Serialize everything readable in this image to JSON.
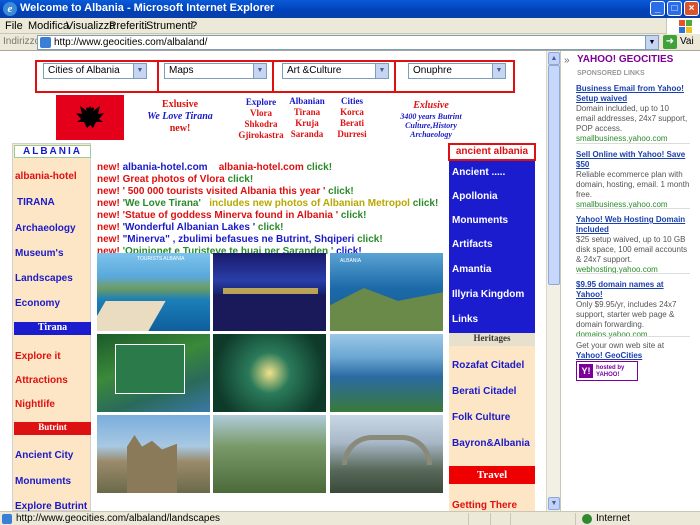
{
  "window": {
    "title": "Welcome to Albania - Microsoft Internet Explorer",
    "min": "_",
    "max": "□",
    "close": "×"
  },
  "menu": [
    "File",
    "Modifica",
    "Visualizza",
    "Preferiti",
    "Strumenti",
    "?"
  ],
  "address": {
    "label": "Indirizzo",
    "url": "http://www.geocities.com/albaland/",
    "go": "Vai"
  },
  "nav_selects": [
    "Cities of Albania",
    "Maps",
    "Art &Culture",
    "Onuphre"
  ],
  "header": {
    "exlusive1": "Exlusive",
    "welove": "We Love Tirana",
    "new": "new!",
    "explore_lines": [
      "Explore",
      "Vlora",
      "Shkodra",
      "Gjirokastra"
    ],
    "albanian_lines": [
      "Albanian",
      "Tirana",
      "Kruja",
      "Saranda"
    ],
    "cities_lines": [
      "Cities",
      "Korca",
      "Berati",
      "Durresi"
    ],
    "exlusive2": "Exlusive",
    "years_lines": [
      "3400 years Butrint",
      "Culture,History",
      "Archaeology"
    ]
  },
  "left_col": {
    "heading": "ALBANIA",
    "items1": [
      "albania-hotel",
      "TIRANA",
      "Archaeology",
      "Museum's",
      "Landscapes",
      "Economy"
    ],
    "tirana_head": "Tirana",
    "items2": [
      "Explore it",
      "Attractions",
      "Nightlife"
    ],
    "butrint_head": "Butrint",
    "items3": [
      "Ancient City",
      "Monuments",
      "Explore Butrint"
    ]
  },
  "right_col": {
    "heading": "ancient albania",
    "items1": [
      "Ancient .....",
      "Apollonia",
      "Monuments",
      "Artifacts",
      "Amantia",
      "Illyria Kingdom",
      "Links"
    ],
    "heritages_head": "Heritages",
    "items2": [
      "Rozafat Citadel",
      "Berati Citadel",
      "Folk Culture",
      "Bayron&Albania"
    ],
    "travel_head": "Travel",
    "items3": [
      "Getting There"
    ]
  },
  "news": [
    {
      "new": "new!",
      "text": "albania-hotel.com",
      "text2": "albania-hotel.com",
      "click": "click!"
    },
    {
      "new": "new!",
      "text": "Great photos of Vlora",
      "click": "click!"
    },
    {
      "new": "new!",
      "text": "' 500 000 tourists visited Albania this year '",
      "click": "click!"
    },
    {
      "new": "new!",
      "text": "'We Love Tirana'",
      "text2": "includes new photos of Albanian Metropol",
      "click": "click!"
    },
    {
      "new": "new!",
      "text": "'Statue of goddess Minerva found in Albania '",
      "click": "click!"
    },
    {
      "new": "new!",
      "text": "'Wonderful Albanian Lakes '",
      "click": "click!"
    },
    {
      "new": "new!",
      "text": "\"Minerva\" , zbulimi befasues ne Butrint, Shqiperi",
      "click": "click!"
    },
    {
      "new": "new!",
      "text": "'Opinionet e Turisteve te huaj per Saranden '",
      "click": "click!"
    }
  ],
  "photo_captions": [
    "TOURISTS ALBANIA",
    "ALBANIA"
  ],
  "sidebar": {
    "logo": "YAHOO! GEOCITIES",
    "sponsored": "SPONSORED LINKS",
    "ads": [
      {
        "title": "Business Email from Yahoo! Setup waived",
        "body": "Domain included, up to 10 email addresses, 24x7 support, POP access.",
        "url": "smallbusiness.yahoo.com"
      },
      {
        "title": "Sell Online with Yahoo! Save $50",
        "body": "Reliable ecommerce plan with domain, hosting, email. 1 month free.",
        "url": "smallbusiness.yahoo.com"
      },
      {
        "title": "Yahoo! Web Hosting Domain Included",
        "body": "$25 setup waived, up to 10 GB disk space, 100 email accounts & 24x7 support.",
        "url": "webhosting.yahoo.com"
      },
      {
        "title": "$9.95 domain names at Yahoo!",
        "body": "Only $9.95/yr, includes 24x7 support, starter web page & domain forwarding.",
        "url": "domains.yahoo.com"
      }
    ],
    "getown": "Get your own web site at",
    "getown_link": "Yahoo! GeoCities",
    "hosted": "hosted by YAHOO!"
  },
  "status": {
    "url": "http://www.geocities.com/albaland/landscapes",
    "zone": "Internet"
  },
  "colors": {
    "xp_blue": "#0041b8",
    "red": "#dd1111",
    "blue": "#1a1ac8",
    "peach": "#fde6c6",
    "navy": "#1c1ccf"
  }
}
